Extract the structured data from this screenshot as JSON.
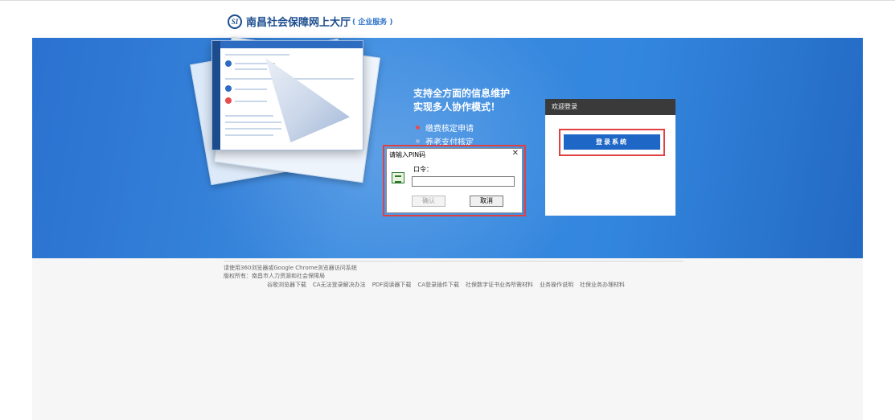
{
  "header": {
    "logo_mark": "SI",
    "title": "南昌社会保障网上大厅",
    "subtitle": "( 企业服务 )"
  },
  "banner": {
    "slogan_line1": "支持全方面的信息维护",
    "slogan_line2": "实现多人协作模式！",
    "bullets": [
      {
        "label": "缴费核定申请",
        "color": "#e84c4c"
      },
      {
        "label": "养老支付核定",
        "color": "#9ab8e0"
      }
    ]
  },
  "login": {
    "header": "欢迎登录",
    "button": "登录系统"
  },
  "pin_dialog": {
    "title": "请输入PIN码",
    "close": "✕",
    "label": "口令：",
    "input_value": "",
    "ok": "确认",
    "cancel": "取消"
  },
  "footer": {
    "browser_note": "请使用360浏览器或Google Chrome浏览器访问系统",
    "copyright": "版权所有：南昌市人力资源和社会保障局",
    "links": [
      "谷歌浏览器下载",
      "CA无法登录解决办法",
      "PDF阅读器下载",
      "CA登录插件下载",
      "社保数字证书业务所需材料",
      "业务操作说明",
      "社保业务办理材料"
    ]
  }
}
